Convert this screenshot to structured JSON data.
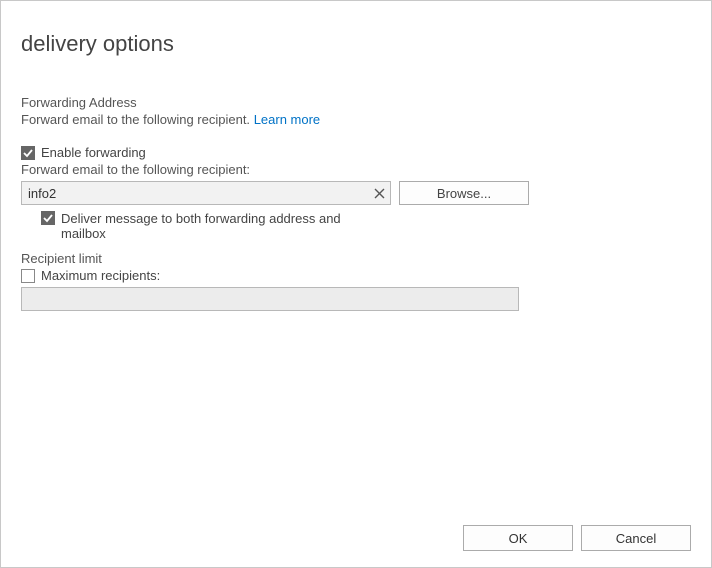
{
  "title": "delivery options",
  "forwarding": {
    "heading": "Forwarding Address",
    "desc": "Forward email to the following recipient.",
    "learn_more": "Learn more",
    "enable_label": "Enable forwarding",
    "recipient_label": "Forward email to the following recipient:",
    "recipient_value": "info2",
    "browse_label": "Browse...",
    "deliver_both_label": "Deliver message to both forwarding address and mailbox"
  },
  "recipient_limit": {
    "heading": "Recipient limit",
    "max_label": "Maximum recipients:",
    "max_value": ""
  },
  "buttons": {
    "ok": "OK",
    "cancel": "Cancel"
  }
}
